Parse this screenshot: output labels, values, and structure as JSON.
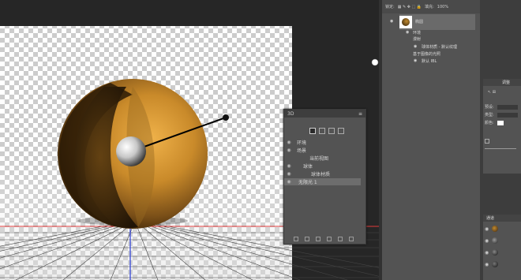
{
  "panel3d": {
    "title": "3D",
    "rows": [
      {
        "label": "环境"
      },
      {
        "label": "场景"
      },
      {
        "label": "当前视图"
      },
      {
        "label": "球体"
      },
      {
        "label": "球体材质"
      },
      {
        "label": "无限光 1"
      }
    ]
  },
  "layers": {
    "opacity_label": "锁定:",
    "fill_label": "填充:",
    "fill_value": "100%",
    "layer_name": "椭圆",
    "sub1": "环境",
    "sub2": "漫射",
    "sub3": "球体材质 - 默认纹理",
    "sub4": "基于图像的光照",
    "sub5": "默认 IBL"
  },
  "props": {
    "tab1": "调整",
    "label1": "预设:",
    "label2": "类型:",
    "label3": "颜色:"
  },
  "channels": {
    "tab": "通道"
  },
  "colors": {
    "accent_red": "#e03a3a",
    "accent_blue": "#2a3cd8"
  }
}
